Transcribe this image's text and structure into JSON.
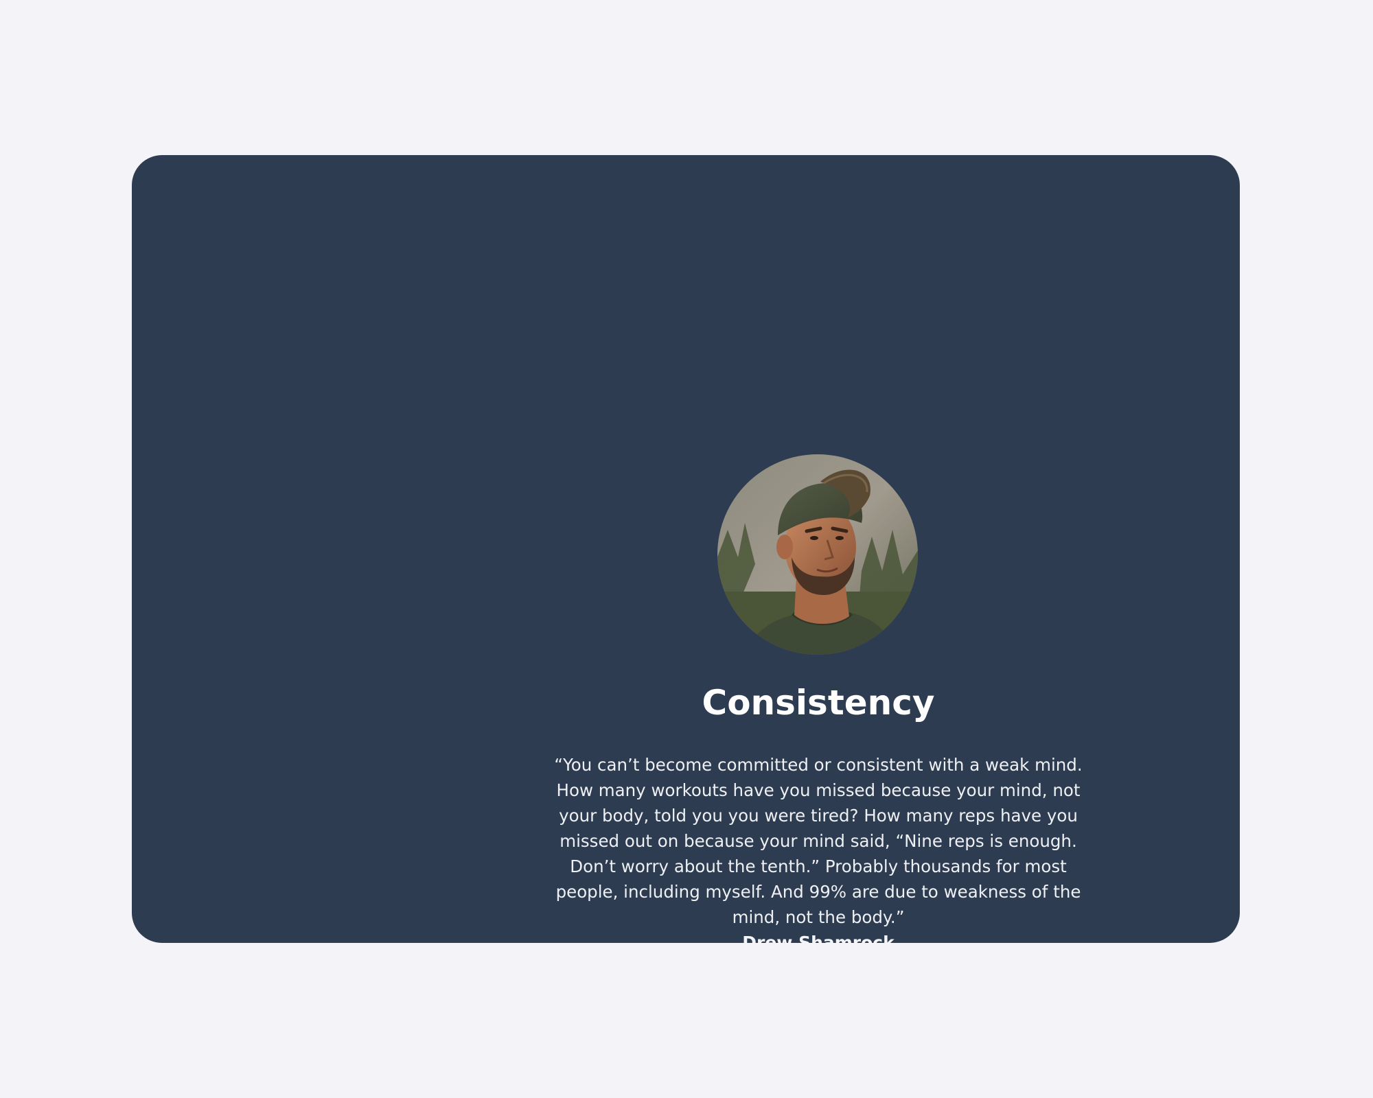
{
  "testimonial": {
    "title": "Consistency",
    "quote": "“You can’t become committed or consistent with a weak mind. How many workouts have you missed because your mind, not your body, told you you were tired? How many reps have you missed out on because your mind said, “Nine reps is enough. Don’t worry about the tenth.” Probably thousands for most people, including myself. And 99% are due to weakness of the mind, not the body.”",
    "author": "Drew Shamrock"
  },
  "colors": {
    "page_background": "#f4f4f8",
    "card_background": "#2d3c50",
    "text": "#ffffff"
  }
}
